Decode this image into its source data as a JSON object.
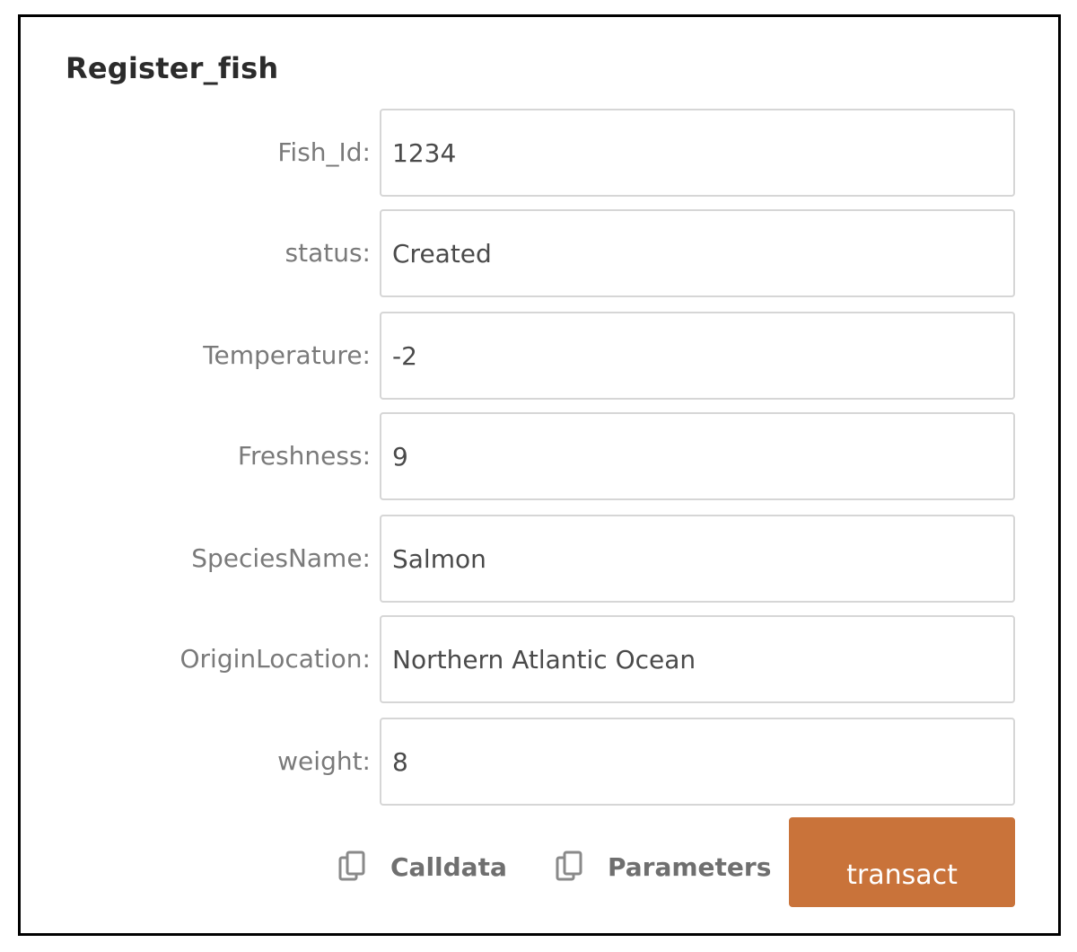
{
  "panel": {
    "title": "Register_fish"
  },
  "fields": [
    {
      "label": "Fish_Id:",
      "value": "1234"
    },
    {
      "label": "status:",
      "value": "Created"
    },
    {
      "label": "Temperature:",
      "value": "-2"
    },
    {
      "label": "Freshness:",
      "value": "9"
    },
    {
      "label": "SpeciesName:",
      "value": "Salmon"
    },
    {
      "label": "OriginLocation:",
      "value": "Northern Atlantic Ocean"
    },
    {
      "label": "weight:",
      "value": "8"
    }
  ],
  "actions": {
    "calldata_label": "Calldata",
    "calldata_icon": "copy-icon",
    "parameters_label": "Parameters",
    "parameters_icon": "copy-icon",
    "transact_label": "transact"
  },
  "colors": {
    "transact_button": "#c9733a",
    "label_text": "#7a7a7a",
    "input_border": "#d6d6d6"
  }
}
